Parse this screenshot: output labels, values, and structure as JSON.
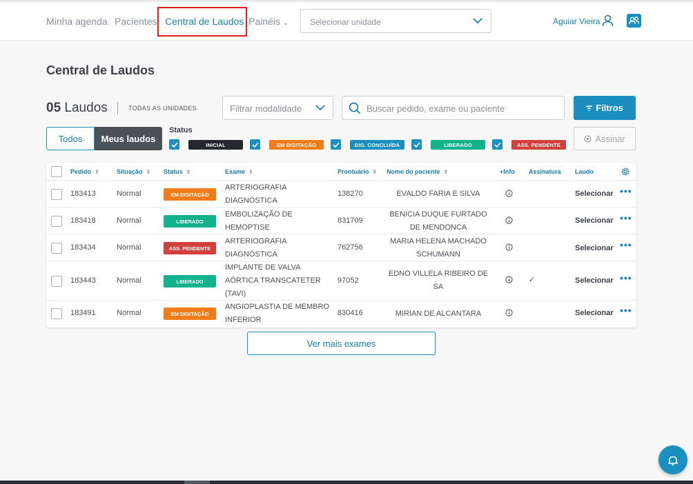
{
  "nav": {
    "items": [
      {
        "label": "Minha agenda",
        "active": false
      },
      {
        "label": "Pacientes",
        "active": false
      },
      {
        "label": "Central de Laudos",
        "active": true
      },
      {
        "label": "Painéis",
        "active": false
      }
    ],
    "unit_placeholder": "Selecionar unidade",
    "user_name": "Aguiar Vieira"
  },
  "page": {
    "title": "Central de Laudos",
    "count_number": "05",
    "count_label": "Laudos",
    "units_label": "TODAS AS UNIDADES",
    "modality_placeholder": "Filtrar modalidade",
    "search_placeholder": "Buscar pedido, exame ou paciente",
    "filters_label": "Filtros",
    "sign_label": "Assinar",
    "seg_all": "Todos",
    "seg_mine": "Meus laudos",
    "status_title": "Status",
    "more_label": "Ver mais exames"
  },
  "status_filters": [
    {
      "label": "INICIAL",
      "color": "#25282c",
      "checked": true
    },
    {
      "label": "EM DIGITAÇÃO",
      "color": "#f07d1a",
      "checked": true
    },
    {
      "label": "DIG. CONCLUÍDA",
      "color": "#1a8fc0",
      "checked": true
    },
    {
      "label": "LIBERADO",
      "color": "#12b28c",
      "checked": true
    },
    {
      "label": "ASS. PENDENTE",
      "color": "#d33f3a",
      "checked": true
    }
  ],
  "table": {
    "headers": {
      "pedido": "Pedido",
      "situacao": "Situação",
      "status": "Status",
      "exame": "Exame",
      "prontuario": "Prontuário",
      "paciente": "Nome do paciente",
      "info": "+Info",
      "assinatura": "Assinatura",
      "laudo": "Laudo"
    },
    "rows": [
      {
        "pedido": "183413",
        "situacao": "Normal",
        "status": "EM DIGITAÇÃO",
        "status_color": "#f07d1a",
        "exame": "ARTERIOGRAFIA DIAGNÓSTICA",
        "prontuario": "138270",
        "paciente": "EVALDO FARIA E SILVA",
        "assinatura": "",
        "laudo": "Selecionar"
      },
      {
        "pedido": "183418",
        "situacao": "Normal",
        "status": "LIBERADO",
        "status_color": "#12b28c",
        "exame": "EMBOLIZAÇÃO DE HEMOPTISE",
        "prontuario": "831709",
        "paciente": "BENICIA DUQUE FURTADO DE MENDONCA",
        "assinatura": "",
        "laudo": "Selecionar"
      },
      {
        "pedido": "183434",
        "situacao": "Normal",
        "status": "ASS. PENDENTE",
        "status_color": "#d33f3a",
        "exame": "ARTERIOGRAFIA DIAGNÓSTICA",
        "prontuario": "762756",
        "paciente": "MARIA HELENA MACHADO SCHUMANN",
        "assinatura": "",
        "laudo": "Selecionar"
      },
      {
        "pedido": "183443",
        "situacao": "Normal",
        "status": "LIBERADO",
        "status_color": "#12b28c",
        "exame": "IMPLANTE DE VALVA AÓRTICA TRANSCATETER (TAVI)",
        "prontuario": "97052",
        "paciente": "EDNO VILLELA RIBEIRO DE SA",
        "assinatura": "✓",
        "laudo": "Selecionar"
      },
      {
        "pedido": "183491",
        "situacao": "Normal",
        "status": "EM DIGITAÇÃO",
        "status_color": "#f07d1a",
        "exame": "ANGIOPLASTIA DE MEMBRO INFERIOR",
        "prontuario": "830416",
        "paciente": "MIRIAN DE ALCANTARA",
        "assinatura": "",
        "laudo": "Selecionar"
      }
    ]
  },
  "colors": {
    "accent": "#1a8fc0",
    "active_highlight": "#e01b1b"
  }
}
